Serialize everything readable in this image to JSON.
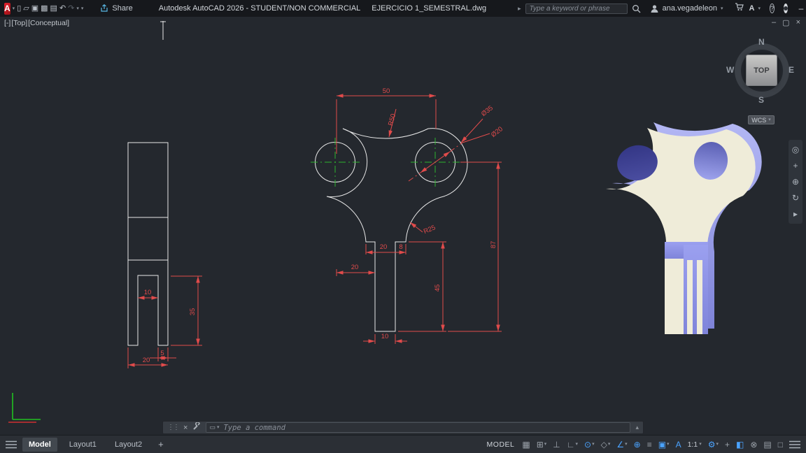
{
  "titlebar": {
    "share_label": "Share",
    "app_title": "Autodesk AutoCAD 2026 - STUDENT/NON COMMERCIAL",
    "doc_title": "EJERCICIO 1_SEMESTRAL.dwg",
    "search_placeholder": "Type a keyword or phrase",
    "username": "ana.vegadeleon"
  },
  "viewport": {
    "controls": {
      "menu": "[-]",
      "view": "[Top]",
      "visual_style": "[Conceptual]"
    },
    "wcs_label": "WCS",
    "viewcube": {
      "top": "TOP",
      "north": "N",
      "south": "S",
      "east": "E",
      "west": "W"
    }
  },
  "command_line": {
    "placeholder": "Type a command"
  },
  "statusbar": {
    "tabs": {
      "model": "Model",
      "layout1": "Layout1",
      "layout2": "Layout2"
    },
    "space_label": "MODEL",
    "annotation_scale": "1:1"
  },
  "dimensions": {
    "left_view": {
      "slot_width": "10",
      "leg_height": "35",
      "leg_width": "5",
      "overall_width": "20"
    },
    "plan_view": {
      "hole_spacing": "50",
      "saddle_radius": "R50",
      "boss_diameter": "Ø35",
      "hole_diameter": "Ø20",
      "fillet_radius": "R25",
      "neck_width": "20",
      "step_width": "8",
      "offset": "20",
      "stem_height": "45",
      "overall_height": "87",
      "stem_width": "10"
    }
  },
  "icons": {
    "logo": "A",
    "caret_down": "▾",
    "caret_right": "▸",
    "new_file": "▯",
    "open": "▱",
    "save": "▣",
    "save_as": "▩",
    "plot": "▤",
    "undo": "↶",
    "redo": "↷",
    "minimize": "–",
    "maximize": "□",
    "close": "×",
    "vp_minimize": "–",
    "vp_restore": "▢",
    "vp_close": "×",
    "help": "?",
    "access": "A",
    "grip": "⋮",
    "recent_box": "▭",
    "scroll_up": "▴",
    "grid": "▦",
    "snap": "⊞",
    "infer": "⊥",
    "ortho": "∟",
    "osnap": "⊙",
    "isodraft": "◇",
    "polar": "∠",
    "otrack": "⊕",
    "lineweight": "≡",
    "cycling": "▣",
    "annotation": "A",
    "gear": "⚙",
    "annotation_monitor": "+",
    "isolate": "◧",
    "performance": "⊗",
    "properties": "▤",
    "clean_screen": "□",
    "plus_tab": "+",
    "nav_wheel": "◎",
    "nav_pan": "+",
    "nav_zoom": "⊕",
    "nav_orbit": "↻",
    "nav_motion": "▸"
  },
  "colors": {
    "accent_blue": "#4aa3ff",
    "dim_red": "#e14b4b",
    "geometry_white": "#e8e8e8",
    "centerline_green": "#2db52d",
    "ucs_green": "#21c021",
    "ucs_red": "#d03030",
    "face_cream": "#efecd9",
    "face_periwinkle": "#9196e4",
    "hole_dark": "#3c3f90"
  }
}
